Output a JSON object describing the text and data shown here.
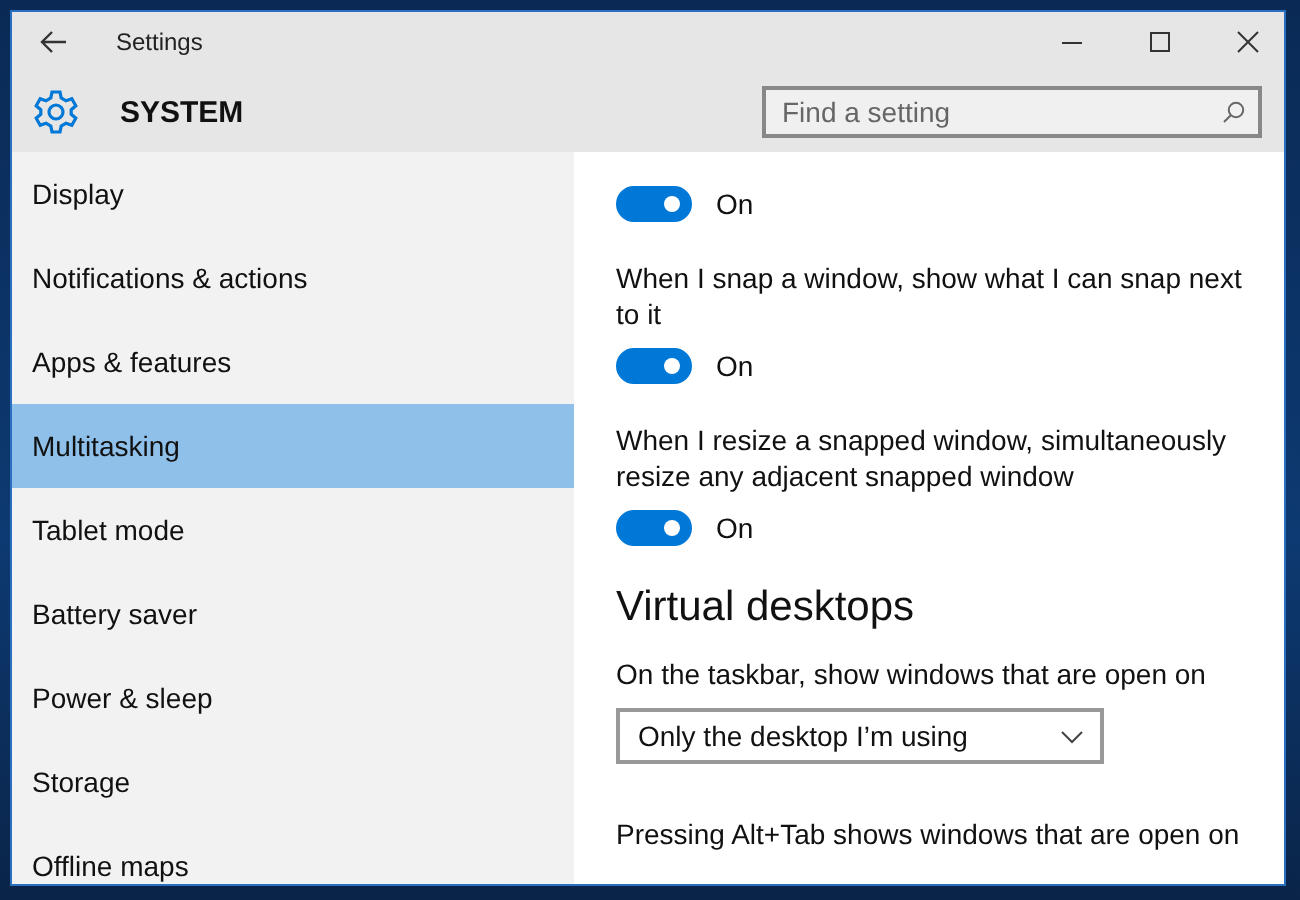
{
  "window": {
    "title": "Settings"
  },
  "header": {
    "title": "SYSTEM",
    "search": {
      "placeholder": "Find a setting"
    }
  },
  "sidebar": {
    "items": [
      {
        "label": "Display",
        "selected": false
      },
      {
        "label": "Notifications & actions",
        "selected": false
      },
      {
        "label": "Apps & features",
        "selected": false
      },
      {
        "label": "Multitasking",
        "selected": true
      },
      {
        "label": "Tablet mode",
        "selected": false
      },
      {
        "label": "Battery saver",
        "selected": false
      },
      {
        "label": "Power & sleep",
        "selected": false
      },
      {
        "label": "Storage",
        "selected": false
      },
      {
        "label": "Offline maps",
        "selected": false
      }
    ]
  },
  "content": {
    "settings": [
      {
        "kind": "toggle",
        "on": true,
        "state_label": "On"
      },
      {
        "kind": "toggle",
        "label": "When I snap a window, show what I can snap next to it",
        "on": true,
        "state_label": "On"
      },
      {
        "kind": "toggle",
        "label": "When I resize a snapped window, simultaneously resize any adjacent snapped window",
        "on": true,
        "state_label": "On"
      },
      {
        "kind": "heading",
        "text": "Virtual desktops"
      },
      {
        "kind": "dropdown",
        "label": "On the taskbar, show windows that are open on",
        "value": "Only the desktop I’m using"
      },
      {
        "kind": "text",
        "label": "Pressing Alt+Tab shows windows that are open on"
      }
    ]
  }
}
